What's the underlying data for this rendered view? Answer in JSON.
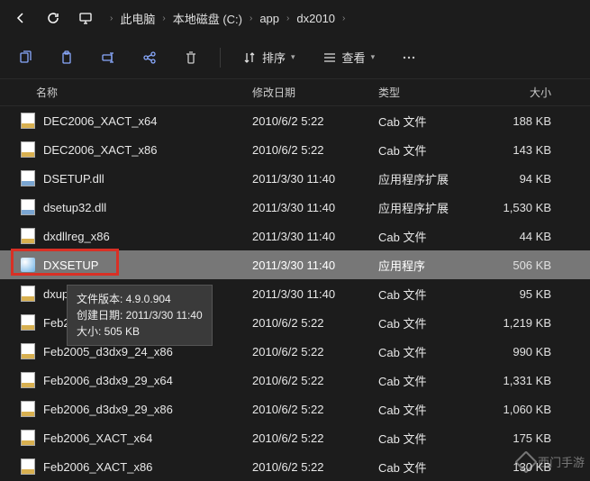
{
  "nav": {
    "breadcrumb": [
      "此电脑",
      "本地磁盘 (C:)",
      "app",
      "dx2010"
    ]
  },
  "toolbar": {
    "sort_label": "排序",
    "view_label": "查看"
  },
  "columns": {
    "name": "名称",
    "date": "修改日期",
    "type": "类型",
    "size": "大小"
  },
  "files": [
    {
      "icon": "cab",
      "name": "DEC2006_XACT_x64",
      "date": "2010/6/2 5:22",
      "type": "Cab 文件",
      "size": "188 KB"
    },
    {
      "icon": "cab",
      "name": "DEC2006_XACT_x86",
      "date": "2010/6/2 5:22",
      "type": "Cab 文件",
      "size": "143 KB"
    },
    {
      "icon": "dll",
      "name": "DSETUP.dll",
      "date": "2011/3/30 11:40",
      "type": "应用程序扩展",
      "size": "94 KB"
    },
    {
      "icon": "dll",
      "name": "dsetup32.dll",
      "date": "2011/3/30 11:40",
      "type": "应用程序扩展",
      "size": "1,530 KB"
    },
    {
      "icon": "cab",
      "name": "dxdllreg_x86",
      "date": "2011/3/30 11:40",
      "type": "Cab 文件",
      "size": "44 KB"
    },
    {
      "icon": "exe",
      "name": "DXSETUP",
      "date": "2011/3/30 11:40",
      "type": "应用程序",
      "size": "506 KB",
      "selected": true
    },
    {
      "icon": "cab",
      "name": "dxupdate",
      "date": "2011/3/30 11:40",
      "type": "Cab 文件",
      "size": "95 KB"
    },
    {
      "icon": "cab",
      "name": "Feb2005_d3dx9_24_x86",
      "date": "2010/6/2 5:22",
      "type": "Cab 文件",
      "size": "1,219 KB"
    },
    {
      "icon": "cab",
      "name": "Feb2005_d3dx9_24_x86",
      "date": "2010/6/2 5:22",
      "type": "Cab 文件",
      "size": "990 KB"
    },
    {
      "icon": "cab",
      "name": "Feb2006_d3dx9_29_x64",
      "date": "2010/6/2 5:22",
      "type": "Cab 文件",
      "size": "1,331 KB"
    },
    {
      "icon": "cab",
      "name": "Feb2006_d3dx9_29_x86",
      "date": "2010/6/2 5:22",
      "type": "Cab 文件",
      "size": "1,060 KB"
    },
    {
      "icon": "cab",
      "name": "Feb2006_XACT_x64",
      "date": "2010/6/2 5:22",
      "type": "Cab 文件",
      "size": "175 KB"
    },
    {
      "icon": "cab",
      "name": "Feb2006_XACT_x86",
      "date": "2010/6/2 5:22",
      "type": "Cab 文件",
      "size": "130 KB"
    }
  ],
  "tooltip": {
    "line1": "文件版本: 4.9.0.904",
    "line2": "创建日期: 2011/3/30 11:40",
    "line3": "大小: 505 KB"
  },
  "watermark": "西门手游"
}
